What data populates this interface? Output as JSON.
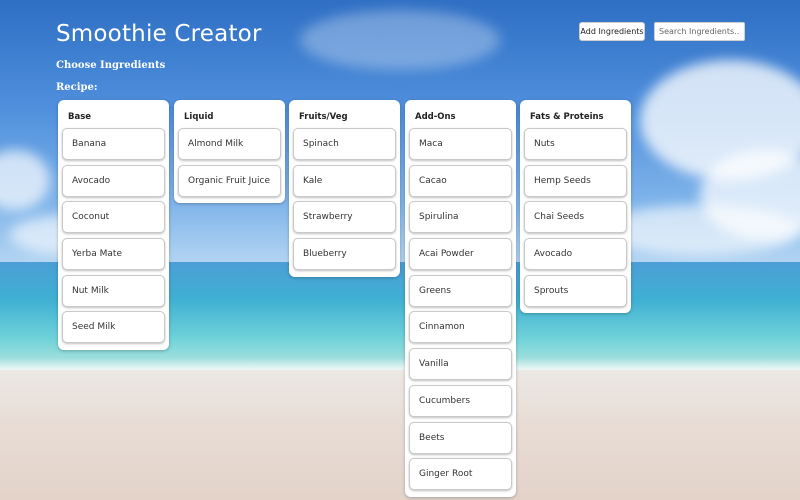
{
  "app": {
    "title": "Smoothie Creator"
  },
  "toolbar": {
    "add_label": "Add Ingredients"
  },
  "search": {
    "placeholder": "Search Ingredients..."
  },
  "labels": {
    "choose": "Choose Ingredients",
    "recipe": "Recipe:"
  },
  "categories": [
    {
      "title": "Base",
      "items": [
        "Banana",
        "Avocado",
        "Coconut",
        "Yerba Mate",
        "Nut Milk",
        "Seed Milk"
      ]
    },
    {
      "title": "Liquid",
      "items": [
        "Almond Milk",
        "Organic Fruit Juice"
      ]
    },
    {
      "title": "Fruits/Veg",
      "items": [
        "Spinach",
        "Kale",
        "Strawberry",
        "Blueberry"
      ]
    },
    {
      "title": "Add-Ons",
      "items": [
        "Maca",
        "Cacao",
        "Spirulina",
        "Acai Powder",
        "Greens",
        "Cinnamon",
        "Vanilla",
        "Cucumbers",
        "Beets",
        "Ginger Root"
      ]
    },
    {
      "title": "Fats & Proteins",
      "items": [
        "Nuts",
        "Hemp Seeds",
        "Chai Seeds",
        "Avocado",
        "Sprouts"
      ]
    }
  ]
}
